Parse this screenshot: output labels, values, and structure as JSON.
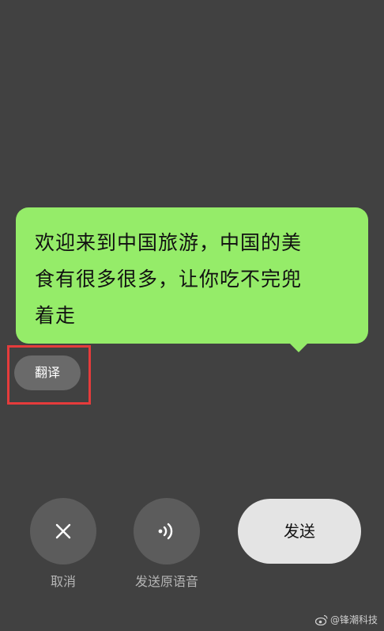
{
  "message": {
    "lines": [
      "欢迎来到中国旅游，中国的美",
      "食有很多很多，让你吃不完兜",
      "着走"
    ]
  },
  "translate_button": {
    "label": "翻译"
  },
  "actions": {
    "cancel": {
      "label": "取消",
      "icon": "close-icon"
    },
    "send_original_voice": {
      "label": "发送原语音",
      "icon": "voice-wave-icon"
    },
    "send": {
      "label": "发送"
    }
  },
  "watermark": {
    "text": "@锋潮科技",
    "icon": "weibo-icon"
  },
  "colors": {
    "background": "#414141",
    "bubble": "#95ec69",
    "highlight": "#e53b3b",
    "send_button": "#e4e4e4"
  }
}
